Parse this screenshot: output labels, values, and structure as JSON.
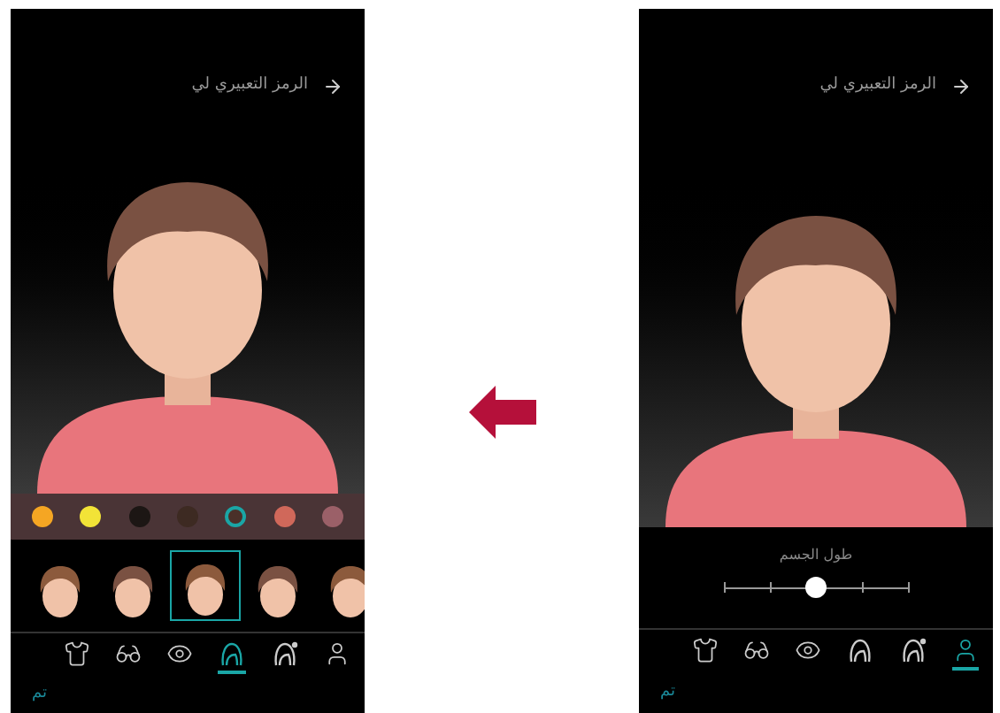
{
  "left_screen": {
    "kind": "colors",
    "header": {
      "title": "الرمز التعبيري لي"
    },
    "swatches": [
      {
        "color": "#f5a623",
        "selected": false
      },
      {
        "color": "#f2e337",
        "selected": false
      },
      {
        "color": "#1c1614",
        "selected": false
      },
      {
        "color": "#3d2a22",
        "selected": false
      },
      {
        "color": "#4a3029",
        "selected": true
      },
      {
        "color": "#d0685a",
        "selected": false
      },
      {
        "color": "#9b6068",
        "selected": false
      }
    ],
    "styles": [
      {
        "selected": false
      },
      {
        "selected": false
      },
      {
        "selected": true
      },
      {
        "selected": false
      },
      {
        "selected": false
      }
    ],
    "tabs": [
      {
        "kind": "shirt",
        "selected": false
      },
      {
        "kind": "glasses",
        "selected": false
      },
      {
        "kind": "eye",
        "selected": false
      },
      {
        "kind": "hair",
        "selected": true
      },
      {
        "kind": "face",
        "selected": false
      },
      {
        "kind": "body",
        "selected": false
      }
    ],
    "done": "تم"
  },
  "right_screen": {
    "kind": "slider",
    "header": {
      "title": "الرمز التعبيري لي"
    },
    "slider": {
      "label": "طول الجسم",
      "level": 0.5
    },
    "tabs": [
      {
        "kind": "shirt",
        "selected": false
      },
      {
        "kind": "glasses",
        "selected": false
      },
      {
        "kind": "eye",
        "selected": false
      },
      {
        "kind": "hair",
        "selected": false
      },
      {
        "kind": "face",
        "selected": false
      },
      {
        "kind": "body",
        "selected": true
      }
    ],
    "done": "تم"
  }
}
